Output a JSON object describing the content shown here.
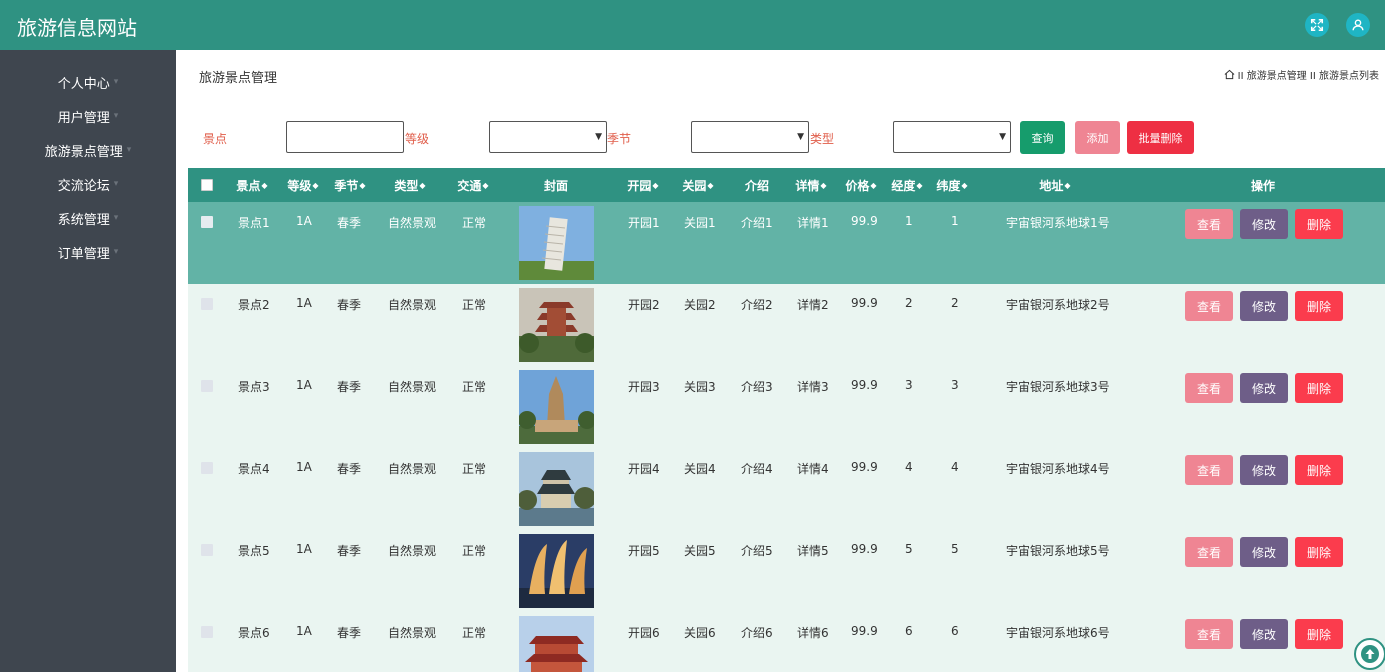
{
  "app": {
    "title": "旅游信息网站"
  },
  "header": {
    "icons": [
      "fullscreen-icon",
      "user-icon"
    ]
  },
  "sidebar": {
    "items": [
      {
        "label": "个人中心"
      },
      {
        "label": "用户管理"
      },
      {
        "label": "旅游景点管理"
      },
      {
        "label": "交流论坛"
      },
      {
        "label": "系统管理"
      },
      {
        "label": "订单管理"
      }
    ]
  },
  "page": {
    "heading": "旅游景点管理",
    "breadcrumb": "II 旅游景点管理 II 旅游景点列表"
  },
  "filters": {
    "spot_label": "景点",
    "spot_value": "",
    "grade_label": "等级",
    "season_label": "季节",
    "type_label": "类型"
  },
  "buttons": {
    "query": "查询",
    "add": "添加",
    "batch_delete": "批量删除"
  },
  "table": {
    "columns": [
      "景点",
      "等级",
      "季节",
      "类型",
      "交通",
      "封面",
      "开园",
      "关园",
      "介绍",
      "详情",
      "价格",
      "经度",
      "纬度",
      "地址",
      "操作"
    ],
    "actions": {
      "view": "查看",
      "edit": "修改",
      "delete": "删除"
    },
    "rows": [
      {
        "spot": "景点1",
        "grade": "1A",
        "season": "春季",
        "type": "自然景观",
        "traffic": "正常",
        "open": "开园1",
        "close": "关园1",
        "intro": "介绍1",
        "detail": "详情1",
        "price": "99.9",
        "lng": "1",
        "lat": "1",
        "address": "宇宙银河系地球1号",
        "selected": true
      },
      {
        "spot": "景点2",
        "grade": "1A",
        "season": "春季",
        "type": "自然景观",
        "traffic": "正常",
        "open": "开园2",
        "close": "关园2",
        "intro": "介绍2",
        "detail": "详情2",
        "price": "99.9",
        "lng": "2",
        "lat": "2",
        "address": "宇宙银河系地球2号",
        "selected": false
      },
      {
        "spot": "景点3",
        "grade": "1A",
        "season": "春季",
        "type": "自然景观",
        "traffic": "正常",
        "open": "开园3",
        "close": "关园3",
        "intro": "介绍3",
        "detail": "详情3",
        "price": "99.9",
        "lng": "3",
        "lat": "3",
        "address": "宇宙银河系地球3号",
        "selected": false
      },
      {
        "spot": "景点4",
        "grade": "1A",
        "season": "春季",
        "type": "自然景观",
        "traffic": "正常",
        "open": "开园4",
        "close": "关园4",
        "intro": "介绍4",
        "detail": "详情4",
        "price": "99.9",
        "lng": "4",
        "lat": "4",
        "address": "宇宙银河系地球4号",
        "selected": false
      },
      {
        "spot": "景点5",
        "grade": "1A",
        "season": "春季",
        "type": "自然景观",
        "traffic": "正常",
        "open": "开园5",
        "close": "关园5",
        "intro": "介绍5",
        "detail": "详情5",
        "price": "99.9",
        "lng": "5",
        "lat": "5",
        "address": "宇宙银河系地球5号",
        "selected": false
      },
      {
        "spot": "景点6",
        "grade": "1A",
        "season": "春季",
        "type": "自然景观",
        "traffic": "正常",
        "open": "开园6",
        "close": "关园6",
        "intro": "介绍6",
        "detail": "详情6",
        "price": "99.9",
        "lng": "6",
        "lat": "6",
        "address": "宇宙银河系地球6号",
        "selected": false
      }
    ]
  },
  "colors": {
    "header_bg": "#2f9282",
    "sidebar_bg": "#3f464f",
    "selected_row": "#62b3a6",
    "row_bg": "#eaf5f1",
    "filter_label": "#e05d4a",
    "query_btn": "#169c6c",
    "add_btn": "#ef8593",
    "batch_delete_btn": "#ee2f43",
    "view_btn": "#ef8593",
    "edit_btn": "#6e5e88",
    "delete_btn": "#fb3c4d"
  }
}
